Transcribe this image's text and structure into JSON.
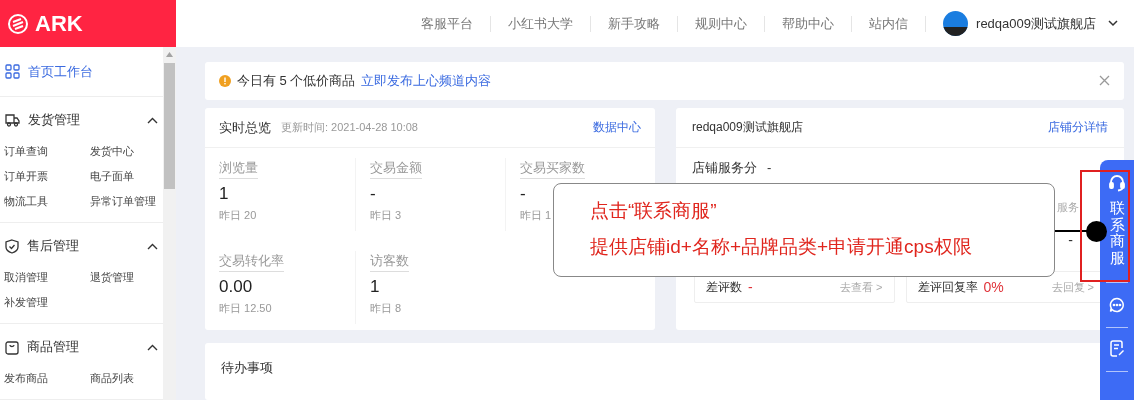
{
  "header": {
    "logo": "ARK",
    "nav": [
      "客服平台",
      "小红书大学",
      "新手攻略",
      "规则中心",
      "帮助中心",
      "站内信"
    ],
    "user": "redqa009测试旗舰店"
  },
  "sidebar": {
    "home": {
      "label": "首页工作台",
      "selected": true
    },
    "sections": [
      {
        "label": "发货管理",
        "expanded": true,
        "children": [
          "订单查询",
          "发货中心",
          "订单开票",
          "电子面单",
          "物流工具",
          "异常订单管理"
        ]
      },
      {
        "label": "售后管理",
        "expanded": true,
        "children": [
          "取消管理",
          "退货管理",
          "补发管理"
        ]
      },
      {
        "label": "商品管理",
        "expanded": true,
        "children": [
          "发布商品",
          "商品列表"
        ]
      }
    ]
  },
  "notice": {
    "text": "今日有 5 个低价商品",
    "link": "立即发布上心频道内容"
  },
  "overview": {
    "title": "实时总览",
    "updated": "更新时间: 2021-04-28 10:08",
    "link": "数据中心",
    "stats": [
      {
        "label": "浏览量",
        "value": "1",
        "yesterday": "昨日 20"
      },
      {
        "label": "交易金额",
        "value": "-",
        "yesterday": "昨日 3"
      },
      {
        "label": "交易买家数",
        "value": "-",
        "yesterday": "昨日 1"
      },
      {
        "label": "交易转化率",
        "value": "0.00",
        "yesterday": "昨日 12.50"
      },
      {
        "label": "访客数",
        "value": "1",
        "yesterday": "昨日 8"
      }
    ]
  },
  "shop": {
    "title": "redqa009测试旗舰店",
    "link": "店铺分详情",
    "score_label": "店铺服务分",
    "score": "-",
    "partial_label": "服务",
    "partial_value": "-",
    "reviews": [
      {
        "label": "差评数",
        "value": "-",
        "action": "去查看 >"
      },
      {
        "label": "差评回复率",
        "value": "0%",
        "action": "去回复 >"
      }
    ]
  },
  "todo": {
    "title": "待办事项"
  },
  "callout": {
    "lines": [
      "点击“联系商服”",
      "提供店铺id+名称+品牌品类+申请开通cps权限"
    ]
  },
  "float_bar": {
    "label": "联系商服"
  }
}
